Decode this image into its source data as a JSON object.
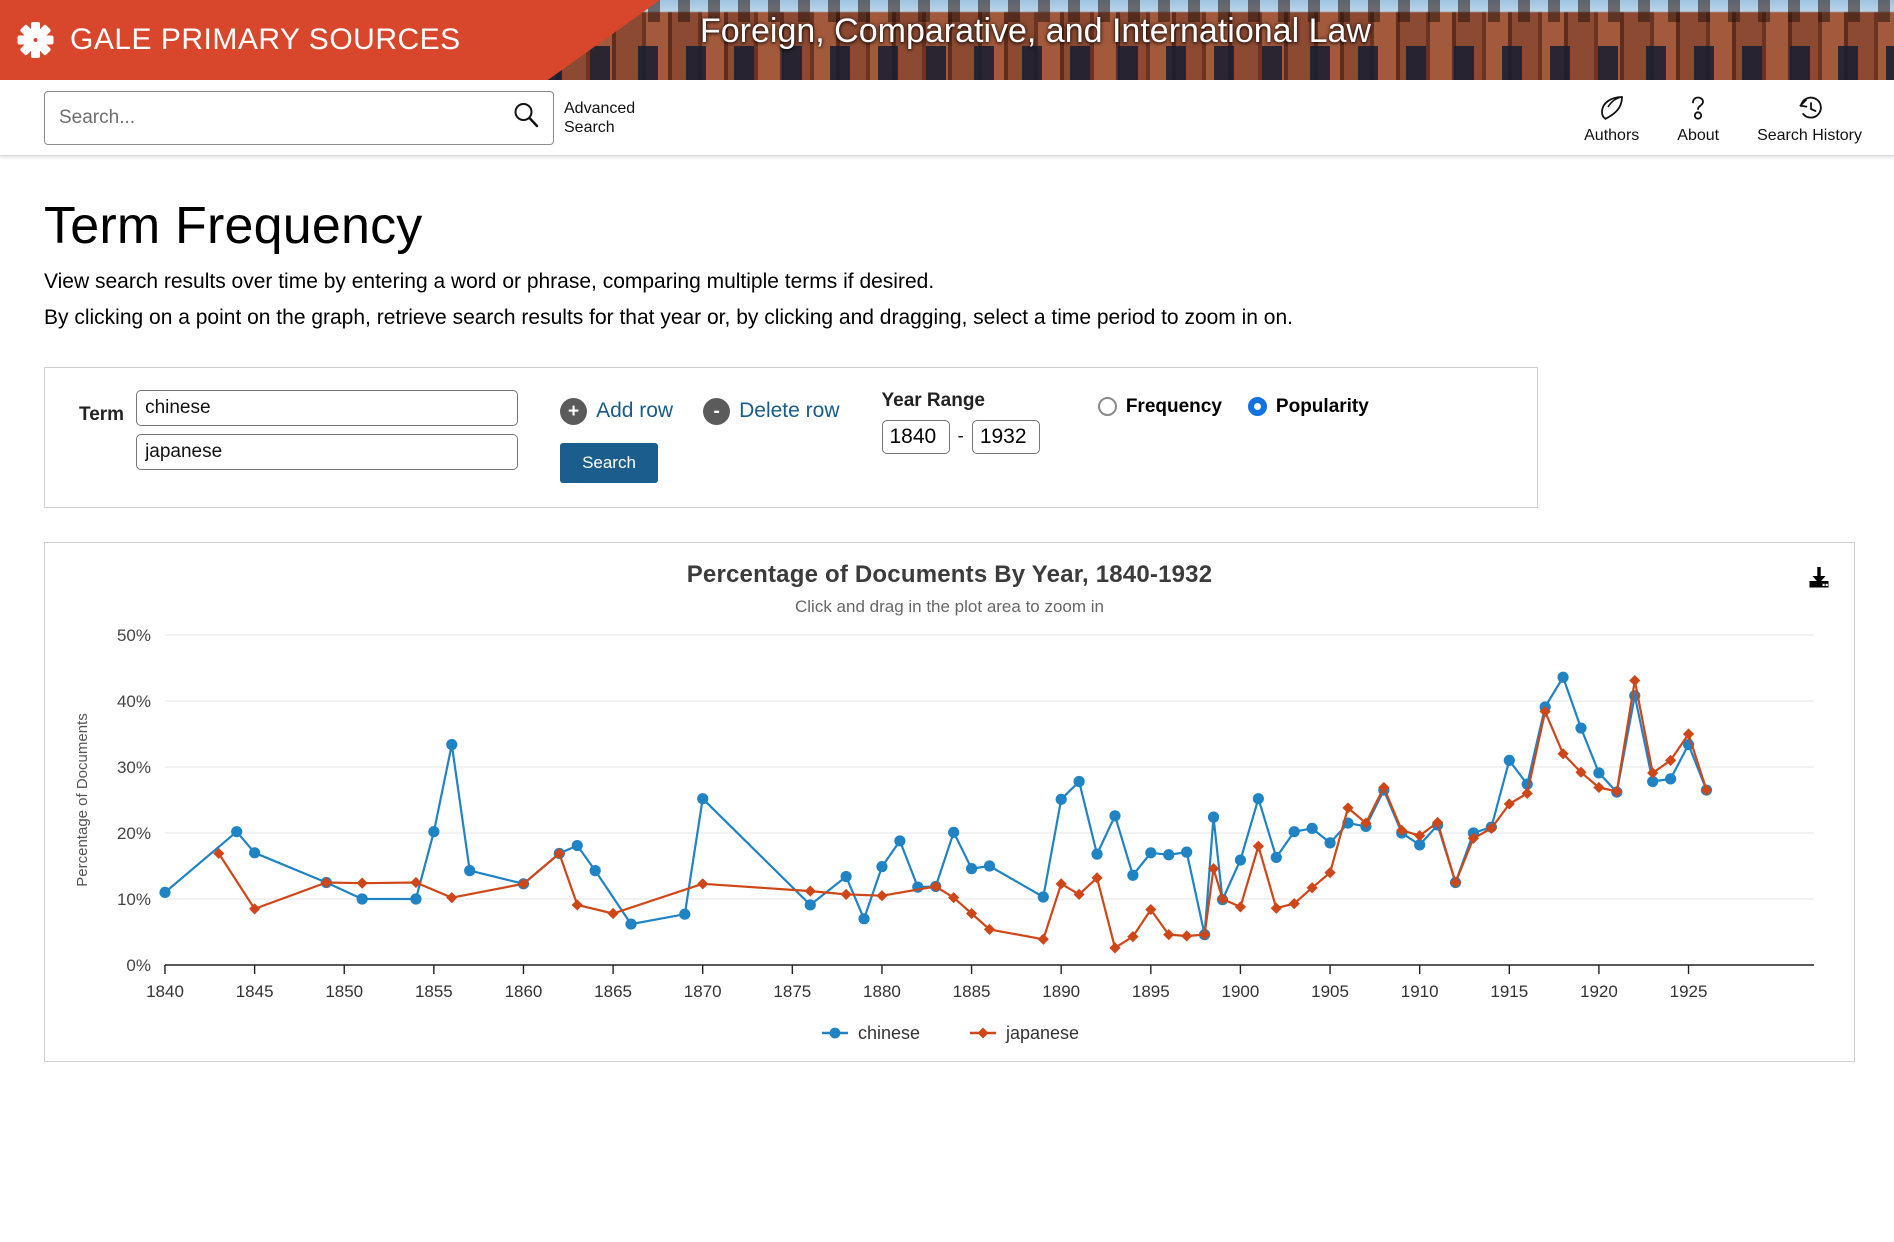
{
  "masthead": {
    "brand": "GALE PRIMARY SOURCES",
    "collection": "Foreign, Comparative, and International Law",
    "brand_color": "#d8472b"
  },
  "search": {
    "placeholder": "Search...",
    "value": "",
    "search_icon": "search-icon",
    "advanced_label": "Advanced Search"
  },
  "top_tools": [
    {
      "label": "Authors",
      "icon": "leaf-icon"
    },
    {
      "label": "About",
      "icon": "question-mark-icon"
    },
    {
      "label": "Search History",
      "icon": "clock-rewind-icon"
    }
  ],
  "page": {
    "title": "Term Frequency",
    "lede1": "View search results over time by entering a word or phrase, comparing multiple terms if desired.",
    "lede2": "By clicking on a point on the graph, retrieve search results for that year or, by clicking and dragging, select a time period to zoom in on."
  },
  "form": {
    "term_label": "Term",
    "terms": [
      "chinese",
      "japanese"
    ],
    "term_placeholder": "",
    "add_row_label": "Add row",
    "add_row_sign": "+",
    "delete_row_label": "Delete row",
    "delete_row_sign": "-",
    "search_button": "Search",
    "year_range_label": "Year Range",
    "year_from": "1840",
    "year_to": "1932",
    "year_dash": "-",
    "modes": [
      {
        "label": "Frequency",
        "selected": false
      },
      {
        "label": "Popularity",
        "selected": true
      }
    ],
    "accent_blue": "#1b5e8e",
    "radio_blue": "#1273e0"
  },
  "chart_panel": {
    "download_icon": "download-icon"
  },
  "chart_data": {
    "type": "line",
    "title": "Percentage of Documents By Year, 1840-1932",
    "subtitle": "Click and drag in the plot area to zoom in",
    "xlabel": "",
    "ylabel": "Percentage of Documents",
    "xlim": [
      1840,
      1932
    ],
    "ylim": [
      0,
      50
    ],
    "ytick_values": [
      0,
      10,
      20,
      30,
      40,
      50
    ],
    "ytick_labels": [
      "0%",
      "10%",
      "20%",
      "30%",
      "40%",
      "50%"
    ],
    "xtick_values": [
      1840,
      1845,
      1850,
      1855,
      1860,
      1865,
      1870,
      1875,
      1880,
      1885,
      1890,
      1895,
      1900,
      1905,
      1910,
      1915,
      1920,
      1925
    ],
    "xtick_labels": [
      "1840",
      "1845",
      "1850",
      "1855",
      "1860",
      "1865",
      "1870",
      "1875",
      "1880",
      "1885",
      "1890",
      "1895",
      "1900",
      "1905",
      "1910",
      "1915",
      "1920",
      "1925"
    ],
    "grid": true,
    "legend_position": "bottom",
    "series": [
      {
        "name": "chinese",
        "color": "#1f83c4",
        "marker": "circle",
        "points": [
          [
            1840,
            11.0
          ],
          [
            1844,
            20.2
          ],
          [
            1845,
            17.0
          ],
          [
            1849,
            12.5
          ],
          [
            1851,
            10.0
          ],
          [
            1854,
            10.0
          ],
          [
            1855,
            20.2
          ],
          [
            1856,
            33.4
          ],
          [
            1857,
            14.3
          ],
          [
            1860,
            12.3
          ],
          [
            1862,
            16.9
          ],
          [
            1863,
            18.1
          ],
          [
            1864,
            14.3
          ],
          [
            1866,
            6.2
          ],
          [
            1869,
            7.7
          ],
          [
            1870,
            25.2
          ],
          [
            1876,
            9.1
          ],
          [
            1878,
            13.4
          ],
          [
            1879,
            7.0
          ],
          [
            1880,
            14.9
          ],
          [
            1881,
            18.8
          ],
          [
            1882,
            11.8
          ],
          [
            1883,
            11.9
          ],
          [
            1884,
            20.1
          ],
          [
            1885,
            14.6
          ],
          [
            1886,
            15.0
          ],
          [
            1889,
            10.3
          ],
          [
            1890,
            25.1
          ],
          [
            1891,
            27.8
          ],
          [
            1892,
            16.8
          ],
          [
            1893,
            22.6
          ],
          [
            1894,
            13.6
          ],
          [
            1895,
            17.0
          ],
          [
            1896,
            16.7
          ],
          [
            1897,
            17.1
          ],
          [
            1898,
            4.6
          ],
          [
            1898.5,
            22.4
          ],
          [
            1899,
            9.9
          ],
          [
            1900,
            15.9
          ],
          [
            1901,
            25.2
          ],
          [
            1902,
            16.3
          ],
          [
            1903,
            20.2
          ],
          [
            1904,
            20.7
          ],
          [
            1905,
            18.5
          ],
          [
            1906,
            21.5
          ],
          [
            1907,
            21.0
          ],
          [
            1908,
            26.5
          ],
          [
            1909,
            20.0
          ],
          [
            1910,
            18.2
          ],
          [
            1911,
            21.2
          ],
          [
            1912,
            12.5
          ],
          [
            1913,
            20.0
          ],
          [
            1914,
            20.9
          ],
          [
            1915,
            31.0
          ],
          [
            1916,
            27.4
          ],
          [
            1917,
            39.1
          ],
          [
            1918,
            43.6
          ],
          [
            1919,
            35.9
          ],
          [
            1920,
            29.1
          ],
          [
            1921,
            26.2
          ],
          [
            1922,
            40.8
          ],
          [
            1923,
            27.8
          ],
          [
            1924,
            28.2
          ],
          [
            1925,
            33.4
          ],
          [
            1926,
            26.5
          ]
        ]
      },
      {
        "name": "japanese",
        "color": "#cf4718",
        "marker": "diamond",
        "points": [
          [
            1843,
            16.9
          ],
          [
            1845,
            8.5
          ],
          [
            1849,
            12.5
          ],
          [
            1851,
            12.4
          ],
          [
            1854,
            12.5
          ],
          [
            1856,
            10.2
          ],
          [
            1860,
            12.3
          ],
          [
            1862,
            16.9
          ],
          [
            1863,
            9.1
          ],
          [
            1865,
            7.8
          ],
          [
            1870,
            12.3
          ],
          [
            1876,
            11.2
          ],
          [
            1878,
            10.7
          ],
          [
            1880,
            10.5
          ],
          [
            1883,
            11.9
          ],
          [
            1884,
            10.2
          ],
          [
            1885,
            7.8
          ],
          [
            1886,
            5.4
          ],
          [
            1889,
            3.9
          ],
          [
            1890,
            12.3
          ],
          [
            1891,
            10.7
          ],
          [
            1892,
            13.2
          ],
          [
            1893,
            2.6
          ],
          [
            1894,
            4.3
          ],
          [
            1895,
            8.4
          ],
          [
            1896,
            4.6
          ],
          [
            1897,
            4.4
          ],
          [
            1898,
            4.6
          ],
          [
            1898.5,
            14.6
          ],
          [
            1899,
            10.0
          ],
          [
            1900,
            8.8
          ],
          [
            1901,
            18.0
          ],
          [
            1902,
            8.6
          ],
          [
            1903,
            9.3
          ],
          [
            1904,
            11.7
          ],
          [
            1905,
            14.0
          ],
          [
            1906,
            23.8
          ],
          [
            1907,
            21.5
          ],
          [
            1908,
            26.9
          ],
          [
            1909,
            20.4
          ],
          [
            1910,
            19.6
          ],
          [
            1911,
            21.6
          ],
          [
            1912,
            12.5
          ],
          [
            1913,
            19.2
          ],
          [
            1914,
            20.7
          ],
          [
            1915,
            24.4
          ],
          [
            1916,
            26.0
          ],
          [
            1917,
            38.4
          ],
          [
            1918,
            32.0
          ],
          [
            1919,
            29.2
          ],
          [
            1920,
            26.9
          ],
          [
            1921,
            26.3
          ],
          [
            1922,
            43.1
          ],
          [
            1923,
            29.1
          ],
          [
            1924,
            31.0
          ],
          [
            1925,
            35.0
          ],
          [
            1926,
            26.5
          ]
        ]
      }
    ]
  }
}
